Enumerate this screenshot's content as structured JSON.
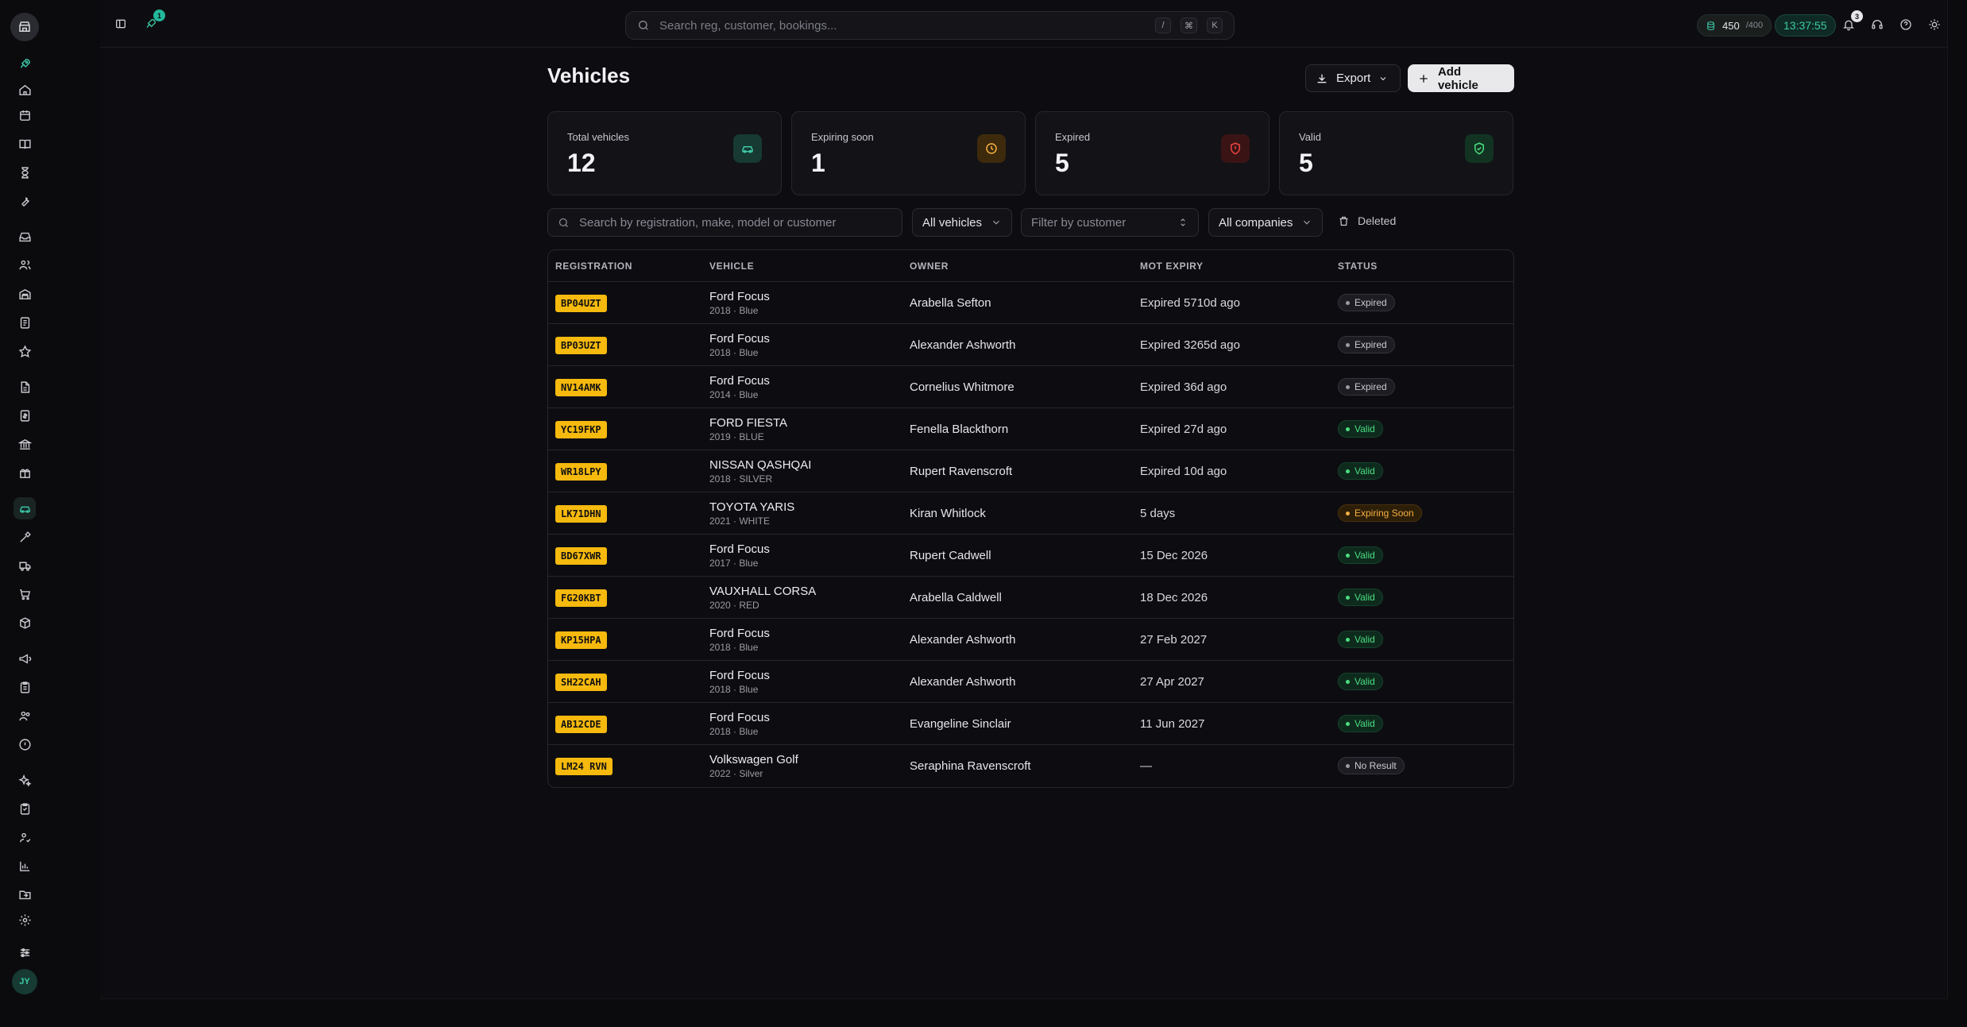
{
  "topbar": {
    "search_placeholder": "Search reg, customer, bookings...",
    "shortcut_keys": [
      "/",
      "⌘",
      "K"
    ],
    "rocket_badge": "1",
    "credits_value": "450",
    "credits_max": "/400",
    "clock": "13:37:55",
    "notifications_count": "3"
  },
  "user": {
    "initials": "JY"
  },
  "page": {
    "title": "Vehicles",
    "export_label": "Export",
    "add_label": "Add vehicle"
  },
  "stats": [
    {
      "label": "Total vehicles",
      "value": "12",
      "icon": "car-icon",
      "color": "#3ec9a7"
    },
    {
      "label": "Expiring soon",
      "value": "1",
      "icon": "clock-icon",
      "color": "#f5b042"
    },
    {
      "label": "Expired",
      "value": "5",
      "icon": "shield-alert-icon",
      "color": "#ef4444"
    },
    {
      "label": "Valid",
      "value": "5",
      "icon": "shield-check-icon",
      "color": "#4ade80"
    }
  ],
  "filters": {
    "search_placeholder": "Search by registration, make, model or customer",
    "vehicles_select": "All vehicles",
    "customer_placeholder": "Filter by customer",
    "companies_select": "All companies",
    "deleted_label": "Deleted"
  },
  "table": {
    "headers": [
      "REGISTRATION",
      "VEHICLE",
      "OWNER",
      "MOT EXPIRY",
      "STATUS"
    ],
    "rows": [
      {
        "reg": "BP04UZT",
        "vehicle": "Ford Focus",
        "details": "2018 · Blue",
        "owner": "Arabella Sefton",
        "mot": "Expired 5710d ago",
        "status": "Expired"
      },
      {
        "reg": "BP03UZT",
        "vehicle": "Ford Focus",
        "details": "2018 · Blue",
        "owner": "Alexander Ashworth",
        "mot": "Expired 3265d ago",
        "status": "Expired"
      },
      {
        "reg": "NV14AMK",
        "vehicle": "Ford Focus",
        "details": "2014 · Blue",
        "owner": "Cornelius Whitmore",
        "mot": "Expired 36d ago",
        "status": "Expired"
      },
      {
        "reg": "YC19FKP",
        "vehicle": "FORD FIESTA",
        "details": "2019 · BLUE",
        "owner": "Fenella Blackthorn",
        "mot": "Expired 27d ago",
        "status": "Valid"
      },
      {
        "reg": "WR18LPY",
        "vehicle": "NISSAN QASHQAI",
        "details": "2018 · SILVER",
        "owner": "Rupert Ravenscroft",
        "mot": "Expired 10d ago",
        "status": "Valid"
      },
      {
        "reg": "LK71DHN",
        "vehicle": "TOYOTA YARIS",
        "details": "2021 · WHITE",
        "owner": "Kiran Whitlock",
        "mot": "5 days",
        "status": "Expiring Soon"
      },
      {
        "reg": "BD67XWR",
        "vehicle": "Ford Focus",
        "details": "2017 · Blue",
        "owner": "Rupert Cadwell",
        "mot": "15 Dec 2026",
        "status": "Valid"
      },
      {
        "reg": "FG20KBT",
        "vehicle": "VAUXHALL CORSA",
        "details": "2020 · RED",
        "owner": "Arabella Caldwell",
        "mot": "18 Dec 2026",
        "status": "Valid"
      },
      {
        "reg": "KP15HPA",
        "vehicle": "Ford Focus",
        "details": "2018 · Blue",
        "owner": "Alexander Ashworth",
        "mot": "27 Feb 2027",
        "status": "Valid"
      },
      {
        "reg": "SH22CAH",
        "vehicle": "Ford Focus",
        "details": "2018 · Blue",
        "owner": "Alexander Ashworth",
        "mot": "27 Apr 2027",
        "status": "Valid"
      },
      {
        "reg": "AB12CDE",
        "vehicle": "Ford Focus",
        "details": "2018 · Blue",
        "owner": "Evangeline Sinclair",
        "mot": "11 Jun 2027",
        "status": "Valid"
      },
      {
        "reg": "LM24 RVN",
        "vehicle": "Volkswagen Golf",
        "details": "2022 · Silver",
        "owner": "Seraphina Ravenscroft",
        "mot": "—",
        "status": "No Result"
      }
    ]
  },
  "colors": {
    "accent": "#3ec9a7",
    "plate": "#f6b90d",
    "valid": "#4ade80",
    "expiring": "#f5b042",
    "expired": "#9b9ba4"
  }
}
